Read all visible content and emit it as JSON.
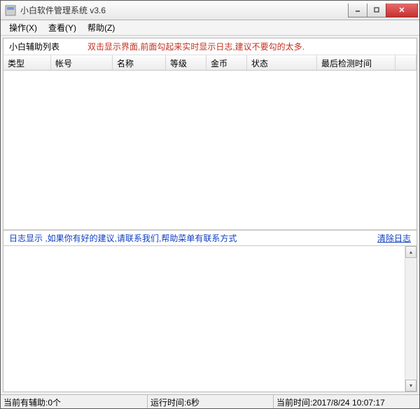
{
  "window": {
    "title": "小白软件管理系统  v3.6"
  },
  "menu": {
    "op": "操作(X)",
    "view": "查看(Y)",
    "help": "帮助(Z)"
  },
  "header": {
    "list_label": "小白辅助列表",
    "hint": "双击显示界面,前面勾起来实时显示日志,建议不要勾的太多."
  },
  "columns": {
    "type": "类型",
    "account": "帐号",
    "name": "名称",
    "level": "等级",
    "gold": "金币",
    "status": "状态",
    "last_check": "最后检测时间"
  },
  "log": {
    "label": "日志显示 ,如果你有好的建议,请联系我们,帮助菜单有联系方式",
    "clear": "清除日志"
  },
  "status": {
    "helpers": "当前有辅助:0个",
    "runtime": "运行时间:6秒",
    "now": "当前时间:2017/8/24 10:07:17"
  }
}
